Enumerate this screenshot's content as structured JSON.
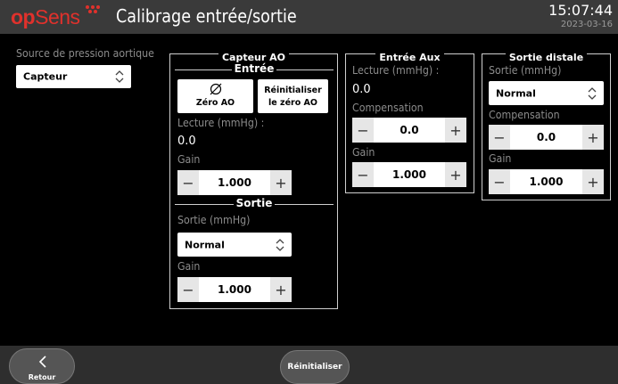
{
  "header": {
    "logo_op": "op",
    "logo_sens": "Sens",
    "title": "Calibrage entrée/sortie",
    "time": "15:07:44",
    "date": "2023-03-16",
    "brand_color": "#e0312c"
  },
  "source": {
    "label": "Source de pression aortique",
    "selected": "Capteur"
  },
  "capteur_ao": {
    "title": "Capteur AO",
    "entree_heading": "Entrée",
    "zero_btn_label": "Zéro AO",
    "zero_icon": "empty-set-icon",
    "reset_zero_line1": "Réinitialiser",
    "reset_zero_line2": "le zéro AO",
    "lecture_label": "Lecture (mmHg) :",
    "lecture_value": "0.0",
    "gain_label": "Gain",
    "gain_value": "1.000",
    "sortie_heading": "Sortie",
    "sortie_label": "Sortie (mmHg)",
    "sortie_selected": "Normal",
    "sortie_gain_label": "Gain",
    "sortie_gain_value": "1.000"
  },
  "entree_aux": {
    "title": "Entrée Aux",
    "lecture_label": "Lecture (mmHg) :",
    "lecture_value": "0.0",
    "compensation_label": "Compensation",
    "compensation_value": "0.0",
    "gain_label": "Gain",
    "gain_value": "1.000"
  },
  "sortie_distale": {
    "title": "Sortie distale",
    "sortie_label": "Sortie (mmHg)",
    "sortie_selected": "Normal",
    "compensation_label": "Compensation",
    "compensation_value": "0.0",
    "gain_label": "Gain",
    "gain_value": "1.000"
  },
  "stepper": {
    "minus": "−",
    "plus": "+"
  },
  "footer": {
    "back_label": "Retour",
    "reset_label": "Réinitialiser"
  }
}
